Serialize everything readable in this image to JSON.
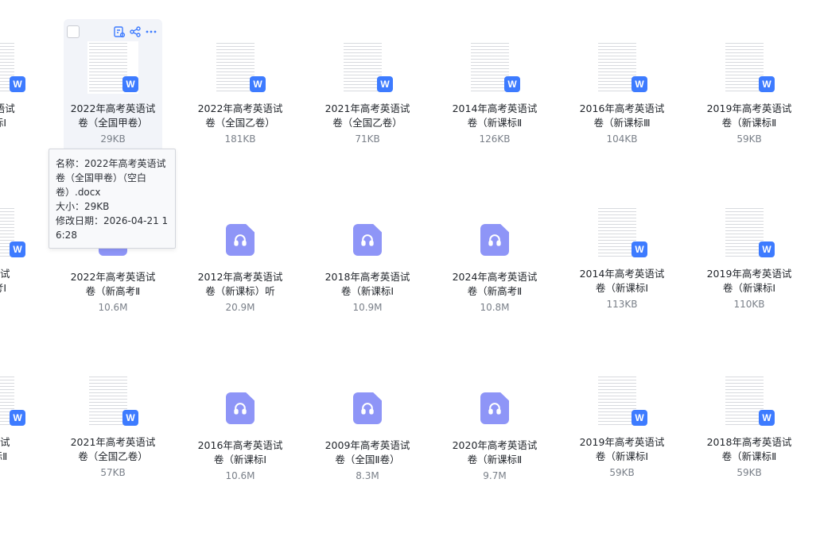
{
  "files": [
    {
      "id": "r1c0",
      "col": 0,
      "row": 0,
      "type": "doc",
      "name": [
        "英语试",
        "标Ⅰ"
      ],
      "size": ""
    },
    {
      "id": "r1c1",
      "col": 1,
      "row": 0,
      "type": "doc",
      "name": [
        "2022年高考英语试",
        "卷（全国甲卷）"
      ],
      "size": "29KB",
      "hovered": true
    },
    {
      "id": "r1c2",
      "col": 2,
      "row": 0,
      "type": "doc",
      "name": [
        "2022年高考英语试",
        "卷（全国乙卷）"
      ],
      "size": "181KB"
    },
    {
      "id": "r1c3",
      "col": 3,
      "row": 0,
      "type": "doc",
      "name": [
        "2021年高考英语试",
        "卷（全国乙卷）"
      ],
      "size": "71KB"
    },
    {
      "id": "r1c4",
      "col": 4,
      "row": 0,
      "type": "doc",
      "name": [
        "2014年高考英语试",
        "卷（新课标Ⅱ"
      ],
      "size": "126KB"
    },
    {
      "id": "r1c5",
      "col": 5,
      "row": 0,
      "type": "doc",
      "name": [
        "2016年高考英语试",
        "卷（新课标Ⅲ"
      ],
      "size": "104KB"
    },
    {
      "id": "r1c6",
      "col": 6,
      "row": 0,
      "type": "doc",
      "name": [
        "2019年高考英语试",
        "卷（新课标Ⅱ"
      ],
      "size": "59KB"
    },
    {
      "id": "r2c0",
      "col": 0,
      "row": 1,
      "type": "doc",
      "name": [
        "语试",
        "考Ⅰ"
      ],
      "size": ""
    },
    {
      "id": "r2c1",
      "col": 1,
      "row": 1,
      "type": "audio",
      "name": [
        "2022年高考英语试",
        "卷（新高考Ⅱ"
      ],
      "size": "10.6M"
    },
    {
      "id": "r2c2",
      "col": 2,
      "row": 1,
      "type": "audio",
      "name": [
        "2012年高考英语试",
        "卷（新课标）听"
      ],
      "size": "20.9M"
    },
    {
      "id": "r2c3",
      "col": 3,
      "row": 1,
      "type": "audio",
      "name": [
        "2018年高考英语试",
        "卷（新课标Ⅰ"
      ],
      "size": "10.9M"
    },
    {
      "id": "r2c4",
      "col": 4,
      "row": 1,
      "type": "audio",
      "name": [
        "2024年高考英语试",
        "卷（新高考Ⅱ"
      ],
      "size": "10.8M"
    },
    {
      "id": "r2c5",
      "col": 5,
      "row": 1,
      "type": "doc",
      "name": [
        "2014年高考英语试",
        "卷（新课标Ⅰ"
      ],
      "size": "113KB"
    },
    {
      "id": "r2c6",
      "col": 6,
      "row": 1,
      "type": "doc",
      "name": [
        "2019年高考英语试",
        "卷（新课标Ⅰ"
      ],
      "size": "110KB"
    },
    {
      "id": "r3c0",
      "col": 0,
      "row": 2,
      "type": "doc",
      "name": [
        "语试",
        "标Ⅱ"
      ],
      "size": ""
    },
    {
      "id": "r3c1",
      "col": 1,
      "row": 2,
      "type": "doc",
      "name": [
        "2021年高考英语试",
        "卷（全国乙卷）"
      ],
      "size": "57KB"
    },
    {
      "id": "r3c2",
      "col": 2,
      "row": 2,
      "type": "audio",
      "name": [
        "2016年高考英语试",
        "卷（新课标Ⅰ"
      ],
      "size": "10.6M"
    },
    {
      "id": "r3c3",
      "col": 3,
      "row": 2,
      "type": "audio",
      "name": [
        "2009年高考英语试",
        "卷（全国Ⅱ卷）"
      ],
      "size": "8.3M"
    },
    {
      "id": "r3c4",
      "col": 4,
      "row": 2,
      "type": "audio",
      "name": [
        "2020年高考英语试",
        "卷（新课标Ⅱ"
      ],
      "size": "9.7M"
    },
    {
      "id": "r3c5",
      "col": 5,
      "row": 2,
      "type": "doc",
      "name": [
        "2019年高考英语试",
        "卷（新课标Ⅰ"
      ],
      "size": "59KB"
    },
    {
      "id": "r3c6",
      "col": 6,
      "row": 2,
      "type": "doc",
      "name": [
        "2018年高考英语试",
        "卷（新课标Ⅱ"
      ],
      "size": "59KB"
    }
  ],
  "tooltip": {
    "lines": [
      "名称：2022年高考英语试",
      "卷（全国甲卷）（空白",
      "卷）.docx",
      "大小：29KB",
      "修改日期：2026-04-21 1",
      "6:28"
    ]
  },
  "colors": {
    "accent": "#3d7bff",
    "audio": "#8e95f7",
    "hover_bg": "#f2f4f9"
  },
  "icons": {
    "doc_badge": "word-doc-icon",
    "audio": "headphones-icon",
    "hover_actions": [
      "image-text-icon",
      "share-icon",
      "more-icon"
    ]
  }
}
